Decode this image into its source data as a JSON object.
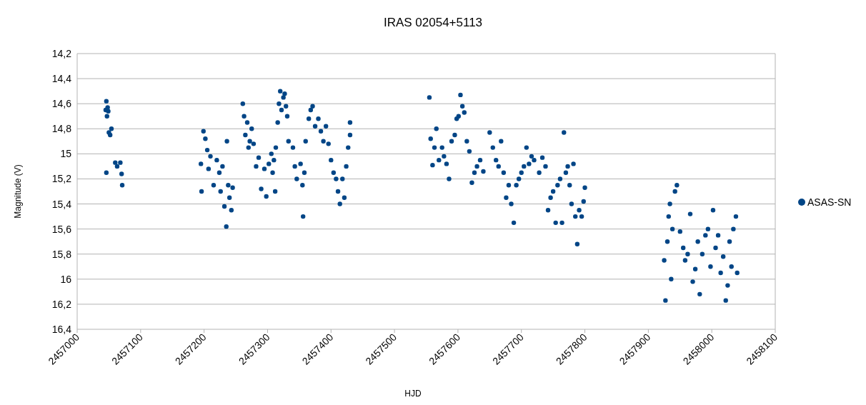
{
  "chart_data": {
    "type": "scatter",
    "title": "IRAS 02054+5113",
    "xlabel": "HJD",
    "ylabel": "Magnitude (V)",
    "grid": true,
    "xlim": [
      2457000,
      2458100
    ],
    "ylim": [
      16.4,
      14.2
    ],
    "xticks": [
      2457000,
      2457100,
      2457200,
      2457300,
      2457400,
      2457500,
      2457600,
      2457700,
      2457800,
      2457900,
      2458000,
      2458100
    ],
    "yticks": [
      {
        "value": 14.2,
        "label": "14,2"
      },
      {
        "value": 14.4,
        "label": "14,4"
      },
      {
        "value": 14.6,
        "label": "14,6"
      },
      {
        "value": 14.8,
        "label": "14,8"
      },
      {
        "value": 15,
        "label": "15"
      },
      {
        "value": 15.2,
        "label": "15,2"
      },
      {
        "value": 15.4,
        "label": "15,4"
      },
      {
        "value": 15.6,
        "label": "15,6"
      },
      {
        "value": 15.8,
        "label": "15,8"
      },
      {
        "value": 16,
        "label": "16"
      },
      {
        "value": 16.2,
        "label": "16,2"
      },
      {
        "value": 16.4,
        "label": "16,4"
      }
    ],
    "x": [
      2457045,
      2457046,
      2457047,
      2457048,
      2457049,
      2457050,
      2457052,
      2457054,
      2457046,
      2457060,
      2457063,
      2457068,
      2457070,
      2457071,
      2457195,
      2457196,
      2457199,
      2457202,
      2457205,
      2457207,
      2457210,
      2457215,
      2457220,
      2457224,
      2457226,
      2457229,
      2457232,
      2457235,
      2457236,
      2457238,
      2457240,
      2457243,
      2457245,
      2457261,
      2457263,
      2457265,
      2457268,
      2457270,
      2457272,
      2457275,
      2457278,
      2457282,
      2457286,
      2457290,
      2457295,
      2457298,
      2457302,
      2457306,
      2457310,
      2457313,
      2457316,
      2457318,
      2457320,
      2457322,
      2457325,
      2457327,
      2457329,
      2457331,
      2457333,
      2457312,
      2457308,
      2457340,
      2457343,
      2457346,
      2457352,
      2457355,
      2457356,
      2457358,
      2457360,
      2457365,
      2457368,
      2457371,
      2457375,
      2457380,
      2457384,
      2457388,
      2457392,
      2457396,
      2457400,
      2457404,
      2457408,
      2457411,
      2457414,
      2457418,
      2457421,
      2457424,
      2457427,
      2457430,
      2457430,
      2457555,
      2457557,
      2457560,
      2457563,
      2457566,
      2457570,
      2457575,
      2457578,
      2457582,
      2457586,
      2457590,
      2457595,
      2457598,
      2457601,
      2457604,
      2457607,
      2457610,
      2457614,
      2457618,
      2457622,
      2457626,
      2457630,
      2457635,
      2457640,
      2457650,
      2457655,
      2457660,
      2457664,
      2457668,
      2457672,
      2457676,
      2457680,
      2457684,
      2457688,
      2457692,
      2457696,
      2457700,
      2457704,
      2457708,
      2457712,
      2457716,
      2457720,
      2457728,
      2457733,
      2457738,
      2457742,
      2457746,
      2457750,
      2457754,
      2457757,
      2457761,
      2457764,
      2457767,
      2457770,
      2457773,
      2457776,
      2457779,
      2457782,
      2457785,
      2457788,
      2457791,
      2457795,
      2457798,
      2457800,
      2457925,
      2457927,
      2457930,
      2457932,
      2457934,
      2457936,
      2457938,
      2457942,
      2457945,
      2457950,
      2457955,
      2457958,
      2457962,
      2457966,
      2457970,
      2457974,
      2457978,
      2457981,
      2457985,
      2457990,
      2457994,
      2457998,
      2458002,
      2458006,
      2458010,
      2458014,
      2458018,
      2458022,
      2458025,
      2458028,
      2458031,
      2458034,
      2458038,
      2458040
    ],
    "series": [
      {
        "name": "ASAS-SN",
        "color": "#004586",
        "values": [
          14.65,
          14.58,
          14.7,
          14.63,
          14.66,
          14.83,
          14.85,
          14.8,
          15.15,
          15.07,
          15.1,
          15.07,
          15.16,
          15.25,
          15.08,
          15.3,
          14.82,
          14.88,
          14.97,
          15.12,
          15.02,
          15.25,
          15.05,
          15.15,
          15.3,
          15.1,
          15.42,
          15.58,
          14.9,
          15.25,
          15.35,
          15.45,
          15.27,
          14.6,
          14.7,
          14.85,
          14.75,
          14.95,
          14.9,
          14.8,
          14.92,
          15.1,
          15.03,
          15.28,
          15.12,
          15.34,
          15.08,
          15.0,
          15.05,
          14.95,
          14.75,
          14.6,
          14.5,
          14.65,
          14.55,
          14.52,
          14.62,
          14.7,
          14.9,
          15.3,
          15.15,
          14.95,
          15.1,
          15.2,
          15.08,
          15.25,
          15.5,
          15.15,
          14.9,
          14.72,
          14.65,
          14.62,
          14.78,
          14.72,
          14.82,
          14.9,
          14.78,
          14.92,
          15.05,
          15.15,
          15.2,
          15.3,
          15.4,
          15.2,
          15.35,
          15.1,
          14.95,
          14.75,
          14.85,
          14.55,
          14.88,
          15.09,
          14.95,
          14.8,
          15.05,
          14.95,
          15.02,
          15.08,
          15.2,
          14.9,
          14.85,
          14.72,
          14.7,
          14.53,
          14.62,
          14.67,
          14.9,
          14.98,
          15.23,
          15.15,
          15.1,
          15.05,
          15.14,
          14.83,
          14.95,
          15.05,
          15.1,
          14.9,
          15.15,
          15.35,
          15.25,
          15.4,
          15.55,
          15.25,
          15.2,
          15.15,
          15.1,
          14.95,
          15.08,
          15.02,
          15.05,
          15.15,
          15.03,
          15.1,
          15.45,
          15.35,
          15.3,
          15.55,
          15.25,
          15.2,
          15.55,
          14.83,
          15.15,
          15.1,
          15.25,
          15.4,
          15.08,
          15.5,
          15.72,
          15.45,
          15.5,
          15.38,
          15.27,
          15.85,
          16.17,
          15.7,
          15.5,
          15.4,
          16.0,
          15.6,
          15.3,
          15.25,
          15.62,
          15.75,
          15.85,
          15.8,
          15.48,
          16.02,
          15.92,
          15.7,
          16.12,
          15.8,
          15.65,
          15.6,
          15.9,
          15.45,
          15.75,
          15.65,
          15.95,
          15.82,
          16.17,
          16.05,
          15.7,
          15.9,
          15.6,
          15.5,
          15.95
        ]
      }
    ]
  }
}
